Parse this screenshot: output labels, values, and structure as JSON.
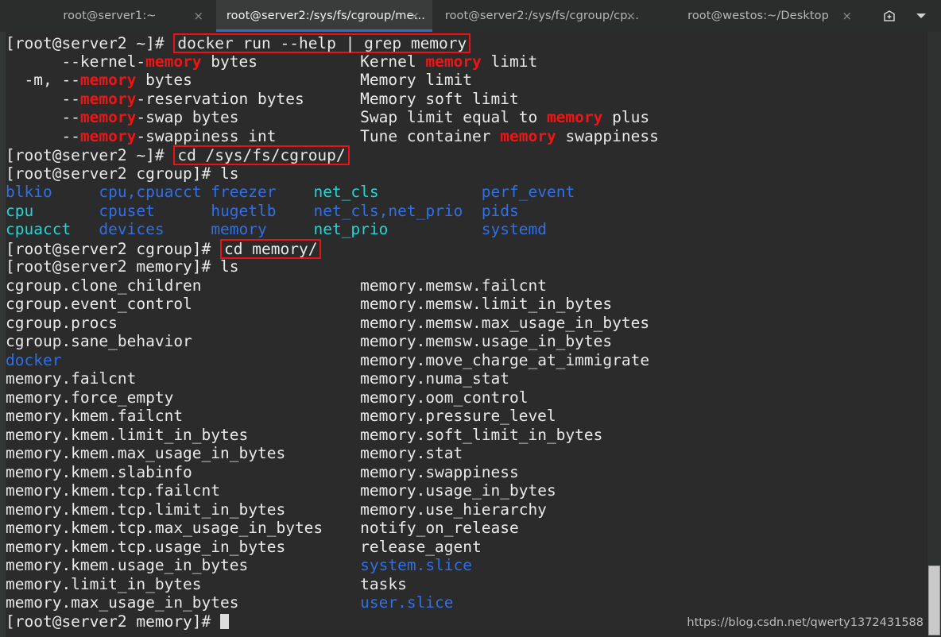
{
  "window": {
    "app": "terminal",
    "colors": {
      "background": "#2b2b2b",
      "tabbar_background": "#2b2d2d",
      "active_tab_background": "#3a3c3c",
      "active_tab_underline": "#2a6fd6",
      "foreground": "#e8e8e8",
      "grep_highlight": "#f01414",
      "directory_blue": "#2f6fe8",
      "symlink_cyan": "#23d6d6",
      "box_outline": "#ee1111"
    }
  },
  "tabs": [
    {
      "label": "root@server1:~",
      "active": false,
      "close": "×"
    },
    {
      "label": "root@server2:/sys/fs/cgroup/me…",
      "active": true,
      "close": "×"
    },
    {
      "label": "root@server2:/sys/fs/cgroup/cp…",
      "active": false,
      "close": "×"
    },
    {
      "label": "root@westos:~/Desktop",
      "active": false,
      "close": "×"
    }
  ],
  "tabbar_actions": [
    {
      "name": "new-tab-icon",
      "glyph": "➕"
    },
    {
      "name": "chevron-down-icon",
      "glyph": "▼"
    }
  ],
  "terminal": {
    "prompt_home": "[root@server2 ~]# ",
    "prompt_cgroup": "[root@server2 cgroup]# ",
    "prompt_memory": "[root@server2 memory]# ",
    "commands": {
      "docker_grep": "docker run --help | grep memory",
      "cd_cgroup": "cd /sys/fs/cgroup/",
      "cd_memory": "cd memory/",
      "ls": "ls"
    },
    "grep_output": [
      {
        "left_pre": "      --kernel-",
        "left_hl": "memory",
        "left_post": " bytes",
        "right_pre": "Kernel ",
        "right_hl": "memory",
        "right_post": " limit"
      },
      {
        "left_pre": "  -m, --",
        "left_hl": "memory",
        "left_post": " bytes",
        "right_pre": "Memory limit",
        "right_hl": "",
        "right_post": ""
      },
      {
        "left_pre": "      --",
        "left_hl": "memory",
        "left_post": "-reservation bytes",
        "right_pre": "Memory soft limit",
        "right_hl": "",
        "right_post": ""
      },
      {
        "left_pre": "      --",
        "left_hl": "memory",
        "left_post": "-swap bytes",
        "right_pre": "Swap limit equal to ",
        "right_hl": "memory",
        "right_post": " plus"
      },
      {
        "left_pre": "      --",
        "left_hl": "memory",
        "left_post": "-swappiness int",
        "right_pre": "Tune container ",
        "right_hl": "memory",
        "right_post": " swappiness"
      }
    ],
    "cgroup_ls": {
      "rows": [
        [
          {
            "text": "blkio",
            "color": "blue"
          },
          {
            "text": "cpu,cpuacct",
            "color": "blue"
          },
          {
            "text": "freezer",
            "color": "blue"
          },
          {
            "text": "net_cls",
            "color": "cyan"
          },
          {
            "text": "perf_event",
            "color": "blue"
          }
        ],
        [
          {
            "text": "cpu",
            "color": "cyan"
          },
          {
            "text": "cpuset",
            "color": "blue"
          },
          {
            "text": "hugetlb",
            "color": "blue"
          },
          {
            "text": "net_cls,net_prio",
            "color": "blue"
          },
          {
            "text": "pids",
            "color": "blue"
          }
        ],
        [
          {
            "text": "cpuacct",
            "color": "cyan"
          },
          {
            "text": "devices",
            "color": "blue"
          },
          {
            "text": "memory",
            "color": "blue"
          },
          {
            "text": "net_prio",
            "color": "cyan"
          },
          {
            "text": "systemd",
            "color": "blue"
          }
        ]
      ]
    },
    "memory_ls": {
      "rows": [
        [
          {
            "text": "cgroup.clone_children",
            "color": "white"
          },
          {
            "text": "memory.memsw.failcnt",
            "color": "white"
          }
        ],
        [
          {
            "text": "cgroup.event_control",
            "color": "white"
          },
          {
            "text": "memory.memsw.limit_in_bytes",
            "color": "white"
          }
        ],
        [
          {
            "text": "cgroup.procs",
            "color": "white"
          },
          {
            "text": "memory.memsw.max_usage_in_bytes",
            "color": "white"
          }
        ],
        [
          {
            "text": "cgroup.sane_behavior",
            "color": "white"
          },
          {
            "text": "memory.memsw.usage_in_bytes",
            "color": "white"
          }
        ],
        [
          {
            "text": "docker",
            "color": "blue"
          },
          {
            "text": "memory.move_charge_at_immigrate",
            "color": "white"
          }
        ],
        [
          {
            "text": "memory.failcnt",
            "color": "white"
          },
          {
            "text": "memory.numa_stat",
            "color": "white"
          }
        ],
        [
          {
            "text": "memory.force_empty",
            "color": "white"
          },
          {
            "text": "memory.oom_control",
            "color": "white"
          }
        ],
        [
          {
            "text": "memory.kmem.failcnt",
            "color": "white"
          },
          {
            "text": "memory.pressure_level",
            "color": "white"
          }
        ],
        [
          {
            "text": "memory.kmem.limit_in_bytes",
            "color": "white"
          },
          {
            "text": "memory.soft_limit_in_bytes",
            "color": "white"
          }
        ],
        [
          {
            "text": "memory.kmem.max_usage_in_bytes",
            "color": "white"
          },
          {
            "text": "memory.stat",
            "color": "white"
          }
        ],
        [
          {
            "text": "memory.kmem.slabinfo",
            "color": "white"
          },
          {
            "text": "memory.swappiness",
            "color": "white"
          }
        ],
        [
          {
            "text": "memory.kmem.tcp.failcnt",
            "color": "white"
          },
          {
            "text": "memory.usage_in_bytes",
            "color": "white"
          }
        ],
        [
          {
            "text": "memory.kmem.tcp.limit_in_bytes",
            "color": "white"
          },
          {
            "text": "memory.use_hierarchy",
            "color": "white"
          }
        ],
        [
          {
            "text": "memory.kmem.tcp.max_usage_in_bytes",
            "color": "white"
          },
          {
            "text": "notify_on_release",
            "color": "white"
          }
        ],
        [
          {
            "text": "memory.kmem.tcp.usage_in_bytes",
            "color": "white"
          },
          {
            "text": "release_agent",
            "color": "white"
          }
        ],
        [
          {
            "text": "memory.kmem.usage_in_bytes",
            "color": "white"
          },
          {
            "text": "system.slice",
            "color": "blue"
          }
        ],
        [
          {
            "text": "memory.limit_in_bytes",
            "color": "white"
          },
          {
            "text": "tasks",
            "color": "white"
          }
        ],
        [
          {
            "text": "memory.max_usage_in_bytes",
            "color": "white"
          },
          {
            "text": "user.slice",
            "color": "blue"
          }
        ]
      ]
    }
  },
  "watermark": "https://blog.csdn.net/qwerty1372431588"
}
